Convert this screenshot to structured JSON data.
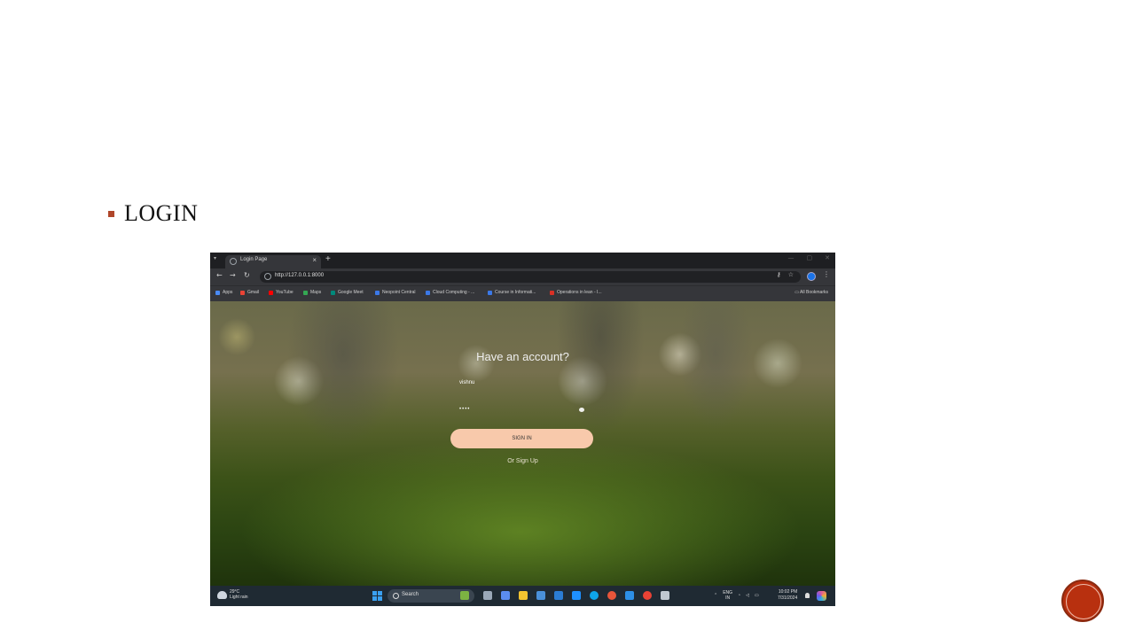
{
  "slide": {
    "bullet_text": "LOGIN",
    "accent_color": "#b0462a"
  },
  "browser": {
    "tab_title": "Login Page",
    "tab_close": "×",
    "new_tab": "+",
    "url": "http://127.0.0.1:8000",
    "bookmarks": [
      {
        "label": "Apps",
        "color": "#4a8af4"
      },
      {
        "label": "Gmail",
        "color": "#ea4335"
      },
      {
        "label": "YouTube",
        "color": "#ff0000"
      },
      {
        "label": "Maps",
        "color": "#34a853"
      },
      {
        "label": "Google Meet",
        "color": "#00897b"
      },
      {
        "label": "Neopoint Central",
        "color": "#3b78e7"
      },
      {
        "label": "Cloud Computing - ...",
        "color": "#3b78e7"
      },
      {
        "label": "Course in Informati...",
        "color": "#3b78e7"
      },
      {
        "label": "Operations in lean - I...",
        "color": "#d93025"
      }
    ],
    "all_bookmarks": "All Bookmarks"
  },
  "login": {
    "title": "Have an account?",
    "username_value": "vishnu",
    "password_value": "••••",
    "signin_label": "SIGN IN",
    "signup_link": "Or Sign Up"
  },
  "taskbar": {
    "weather_temp": "29°C",
    "weather_desc": "Light rain",
    "search_label": "Search",
    "tray_lang": "ENG",
    "tray_region": "IN",
    "clock_time": "10:02 PM",
    "clock_date": "7/31/2024"
  },
  "icons": {
    "start": "windows-start-icon",
    "profile": "profile-avatar-icon"
  }
}
